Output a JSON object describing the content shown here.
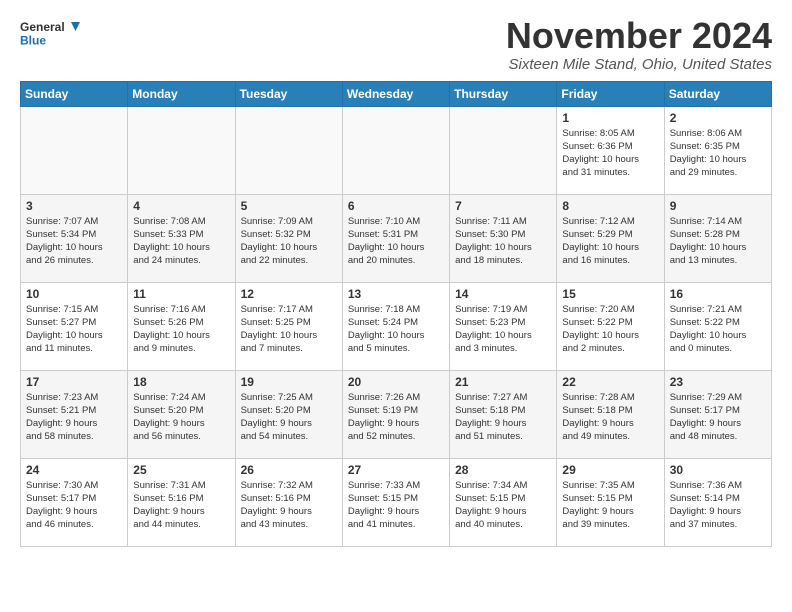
{
  "logo": {
    "line1": "General",
    "line2": "Blue"
  },
  "header": {
    "month": "November 2024",
    "location": "Sixteen Mile Stand, Ohio, United States"
  },
  "days_of_week": [
    "Sunday",
    "Monday",
    "Tuesday",
    "Wednesday",
    "Thursday",
    "Friday",
    "Saturday"
  ],
  "weeks": [
    [
      {
        "day": "",
        "info": ""
      },
      {
        "day": "",
        "info": ""
      },
      {
        "day": "",
        "info": ""
      },
      {
        "day": "",
        "info": ""
      },
      {
        "day": "",
        "info": ""
      },
      {
        "day": "1",
        "info": "Sunrise: 8:05 AM\nSunset: 6:36 PM\nDaylight: 10 hours\nand 31 minutes."
      },
      {
        "day": "2",
        "info": "Sunrise: 8:06 AM\nSunset: 6:35 PM\nDaylight: 10 hours\nand 29 minutes."
      }
    ],
    [
      {
        "day": "3",
        "info": "Sunrise: 7:07 AM\nSunset: 5:34 PM\nDaylight: 10 hours\nand 26 minutes."
      },
      {
        "day": "4",
        "info": "Sunrise: 7:08 AM\nSunset: 5:33 PM\nDaylight: 10 hours\nand 24 minutes."
      },
      {
        "day": "5",
        "info": "Sunrise: 7:09 AM\nSunset: 5:32 PM\nDaylight: 10 hours\nand 22 minutes."
      },
      {
        "day": "6",
        "info": "Sunrise: 7:10 AM\nSunset: 5:31 PM\nDaylight: 10 hours\nand 20 minutes."
      },
      {
        "day": "7",
        "info": "Sunrise: 7:11 AM\nSunset: 5:30 PM\nDaylight: 10 hours\nand 18 minutes."
      },
      {
        "day": "8",
        "info": "Sunrise: 7:12 AM\nSunset: 5:29 PM\nDaylight: 10 hours\nand 16 minutes."
      },
      {
        "day": "9",
        "info": "Sunrise: 7:14 AM\nSunset: 5:28 PM\nDaylight: 10 hours\nand 13 minutes."
      }
    ],
    [
      {
        "day": "10",
        "info": "Sunrise: 7:15 AM\nSunset: 5:27 PM\nDaylight: 10 hours\nand 11 minutes."
      },
      {
        "day": "11",
        "info": "Sunrise: 7:16 AM\nSunset: 5:26 PM\nDaylight: 10 hours\nand 9 minutes."
      },
      {
        "day": "12",
        "info": "Sunrise: 7:17 AM\nSunset: 5:25 PM\nDaylight: 10 hours\nand 7 minutes."
      },
      {
        "day": "13",
        "info": "Sunrise: 7:18 AM\nSunset: 5:24 PM\nDaylight: 10 hours\nand 5 minutes."
      },
      {
        "day": "14",
        "info": "Sunrise: 7:19 AM\nSunset: 5:23 PM\nDaylight: 10 hours\nand 3 minutes."
      },
      {
        "day": "15",
        "info": "Sunrise: 7:20 AM\nSunset: 5:22 PM\nDaylight: 10 hours\nand 2 minutes."
      },
      {
        "day": "16",
        "info": "Sunrise: 7:21 AM\nSunset: 5:22 PM\nDaylight: 10 hours\nand 0 minutes."
      }
    ],
    [
      {
        "day": "17",
        "info": "Sunrise: 7:23 AM\nSunset: 5:21 PM\nDaylight: 9 hours\nand 58 minutes."
      },
      {
        "day": "18",
        "info": "Sunrise: 7:24 AM\nSunset: 5:20 PM\nDaylight: 9 hours\nand 56 minutes."
      },
      {
        "day": "19",
        "info": "Sunrise: 7:25 AM\nSunset: 5:20 PM\nDaylight: 9 hours\nand 54 minutes."
      },
      {
        "day": "20",
        "info": "Sunrise: 7:26 AM\nSunset: 5:19 PM\nDaylight: 9 hours\nand 52 minutes."
      },
      {
        "day": "21",
        "info": "Sunrise: 7:27 AM\nSunset: 5:18 PM\nDaylight: 9 hours\nand 51 minutes."
      },
      {
        "day": "22",
        "info": "Sunrise: 7:28 AM\nSunset: 5:18 PM\nDaylight: 9 hours\nand 49 minutes."
      },
      {
        "day": "23",
        "info": "Sunrise: 7:29 AM\nSunset: 5:17 PM\nDaylight: 9 hours\nand 48 minutes."
      }
    ],
    [
      {
        "day": "24",
        "info": "Sunrise: 7:30 AM\nSunset: 5:17 PM\nDaylight: 9 hours\nand 46 minutes."
      },
      {
        "day": "25",
        "info": "Sunrise: 7:31 AM\nSunset: 5:16 PM\nDaylight: 9 hours\nand 44 minutes."
      },
      {
        "day": "26",
        "info": "Sunrise: 7:32 AM\nSunset: 5:16 PM\nDaylight: 9 hours\nand 43 minutes."
      },
      {
        "day": "27",
        "info": "Sunrise: 7:33 AM\nSunset: 5:15 PM\nDaylight: 9 hours\nand 41 minutes."
      },
      {
        "day": "28",
        "info": "Sunrise: 7:34 AM\nSunset: 5:15 PM\nDaylight: 9 hours\nand 40 minutes."
      },
      {
        "day": "29",
        "info": "Sunrise: 7:35 AM\nSunset: 5:15 PM\nDaylight: 9 hours\nand 39 minutes."
      },
      {
        "day": "30",
        "info": "Sunrise: 7:36 AM\nSunset: 5:14 PM\nDaylight: 9 hours\nand 37 minutes."
      }
    ]
  ]
}
